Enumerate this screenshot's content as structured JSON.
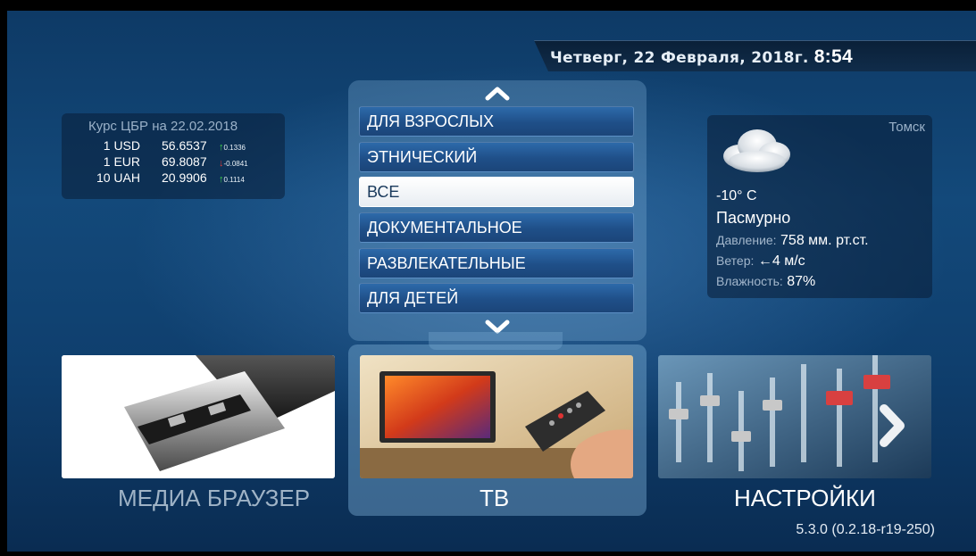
{
  "header": {
    "date": "Четверг, 22 Февраля, 2018г.",
    "time": "8:54"
  },
  "currency": {
    "title": "Курс ЦБР на 22.02.2018",
    "rows": [
      {
        "currency": "1 USD",
        "value": "56.6537",
        "change": "0.1336",
        "direction": "up"
      },
      {
        "currency": "1 EUR",
        "value": "69.8087",
        "change": "-0.0841",
        "direction": "down"
      },
      {
        "currency": "10 UAH",
        "value": "20.9906",
        "change": "0.1114",
        "direction": "up"
      }
    ]
  },
  "menu": {
    "items": [
      {
        "label": "ДЛЯ ВЗРОСЛЫХ",
        "selected": false
      },
      {
        "label": "ЭТНИЧЕСКИЙ",
        "selected": false
      },
      {
        "label": "ВСЕ",
        "selected": true
      },
      {
        "label": "ДОКУМЕНТАЛЬНОЕ",
        "selected": false
      },
      {
        "label": "РАЗВЛЕКАТЕЛЬНЫЕ",
        "selected": false
      },
      {
        "label": "ДЛЯ ДЕТЕЙ",
        "selected": false
      }
    ],
    "up_icon": "chevron-up-icon",
    "down_icon": "chevron-down-icon"
  },
  "weather": {
    "city": "Томск",
    "temperature": "-10° C",
    "condition": "Пасмурно",
    "pressure_label": "Давление:",
    "pressure_value": "758 мм. рт.ст.",
    "wind_label": "Ветер:",
    "wind_value": "←4 м/с",
    "humidity_label": "Влажность:",
    "humidity_value": "87%",
    "icon": "cloud-icon"
  },
  "tiles": [
    {
      "label": "МЕДИА БРАУЗЕР",
      "icon": "usb-drive-icon"
    },
    {
      "label": "ТВ",
      "icon": "tv-remote-icon"
    },
    {
      "label": "НАСТРОЙКИ",
      "icon": "mixer-console-icon"
    }
  ],
  "nav": {
    "left_icon": "chevron-left-icon",
    "right_icon": "chevron-right-icon"
  },
  "version": "5.3.0 (0.2.18-r19-250)",
  "colors": {
    "background": "#13497a",
    "menu_item": "#1f4f88",
    "menu_selected": "#ffffff",
    "change_up": "#3fd44a",
    "change_down": "#e13a3a",
    "dim_label": "#9fb3c6"
  }
}
